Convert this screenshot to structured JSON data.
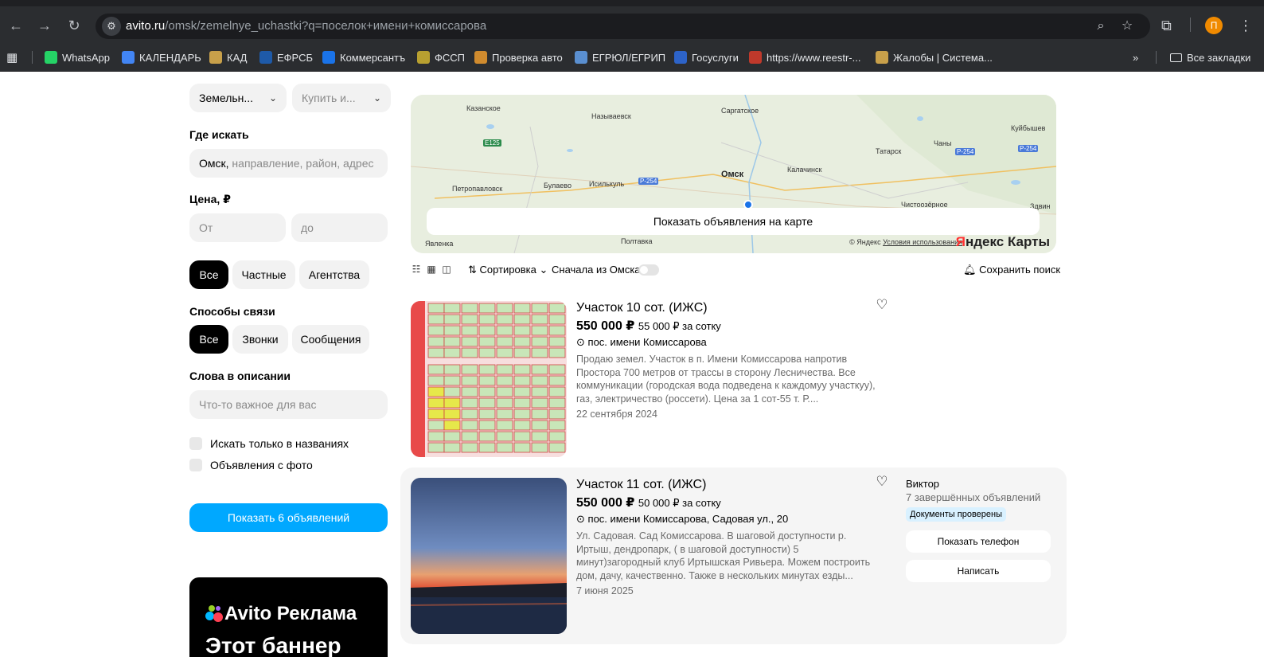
{
  "browser": {
    "url_host": "avito.ru",
    "url_path": "/omsk/zemelnye_uchastki?q=поселок+имени+комиссарова",
    "profile_initial": "П",
    "bookmarks": [
      {
        "label": "WhatsApp",
        "color": "#25d366"
      },
      {
        "label": "КАЛЕНДАРЬ",
        "color": "#4285f4"
      },
      {
        "label": "КАД",
        "color": "#c8a04a"
      },
      {
        "label": "ЕФРСБ",
        "color": "#1e5aa8"
      },
      {
        "label": "Коммерсантъ",
        "color": "#1a73e8"
      },
      {
        "label": "ФССП",
        "color": "#b8a030"
      },
      {
        "label": "Проверка авто",
        "color": "#d08b2e"
      },
      {
        "label": "ЕГРЮЛ/ЕГРИП",
        "color": "#5a8fd0"
      },
      {
        "label": "Госуслуги",
        "color": "#2d63c8"
      },
      {
        "label": "https://www.reestr-...",
        "color": "#c0392b"
      },
      {
        "label": "Жалобы | Система...",
        "color": "#c8a04a"
      }
    ],
    "more": "»",
    "all_bookmarks": "Все закладки"
  },
  "filters": {
    "category": "Земельн...",
    "deal": "Купить и...",
    "where_title": "Где искать",
    "location_city": "Омск,",
    "location_placeholder": "направление, район, адрес",
    "price_title": "Цена, ₽",
    "price_from_placeholder": "От",
    "price_to_placeholder": "до",
    "seller_types": [
      "Все",
      "Частные",
      "Агентства"
    ],
    "contact_title": "Способы связи",
    "contact_types": [
      "Все",
      "Звонки",
      "Сообщения"
    ],
    "words_title": "Слова в описании",
    "words_placeholder": "Что-то важное для вас",
    "check_titles_only": "Искать только в названиях",
    "check_with_photo": "Объявления с фото",
    "show_button": "Показать 6 объявлений"
  },
  "ad": {
    "brand": "Avito Реклама",
    "text": "Этот баннер"
  },
  "map": {
    "button": "Показать объявления на карте",
    "cities": {
      "kazanskoe": "Казанское",
      "nazyvaevsk": "Называевск",
      "saragatskoe": "Саргатское",
      "kuibyshev": "Куйбышев",
      "tatarsk": "Татарск",
      "chany": "Чаны",
      "petropavlovsk": "Петропавловск",
      "bulaevo": "Булаево",
      "isilkul": "Исилькуль",
      "omsk": "Омск",
      "kalachinsk": "Калачинск",
      "chistoozernoe": "Чистоозёрное",
      "zdvin": "Здвин",
      "yavlenka": "Явленка",
      "poltavka": "Полтавка"
    },
    "roads": {
      "e125": "E125",
      "p254a": "P-254",
      "p254b": "P-254",
      "p254c": "P-254"
    },
    "credit_prefix": "© Яндекс",
    "credit_link": "Условия использования",
    "brand_y": "Я",
    "brand_rest": "ндекс Карты"
  },
  "toolbar": {
    "sort": "Сортировка",
    "omsk_first": "Сначала из Омска",
    "save_search": "Сохранить поиск"
  },
  "listings": [
    {
      "title": "Участок 10 сот. (ИЖС)",
      "price": "550 000 ₽",
      "price_per": "55 000 ₽ за сотку",
      "address": "пос. имени Комиссарова",
      "description": "Продаю земел. Участок в п. Имени Комиссарова напротив Простора 700 метров от трассы в сторону Лесничества. Все коммуникации (городская вода подведена к каждомуу участкуу), газ, электричество (россети). Цена за 1 сот-55 т. Р....",
      "date": "22 сентября 2024"
    },
    {
      "title": "Участок 11 сот. (ИЖС)",
      "price": "550 000 ₽",
      "price_per": "50 000 ₽ за сотку",
      "address": "пос. имени Комиссарова, Садовая ул., 20",
      "description": "Ул. Садовая. Сад Комиссарова. В шаговой доступности р. Иртыш, дендропарк, ( в шаговой доступности) 5 минут)загородный клуб Иртышская Ривьера. Можем построить дом, дачу, качественно. Также в нескольких минутах езды...",
      "date": "7 июня 2025",
      "seller": "Виктор",
      "seller_stats": "7 завершённых объявлений",
      "badge": "Документы проверены",
      "phone_button": "Показать телефон",
      "message_button": "Написать"
    }
  ],
  "colors": {
    "accent": "#00a8ff",
    "chrome": "#2b2d30",
    "badge": "#d9f1ff"
  }
}
